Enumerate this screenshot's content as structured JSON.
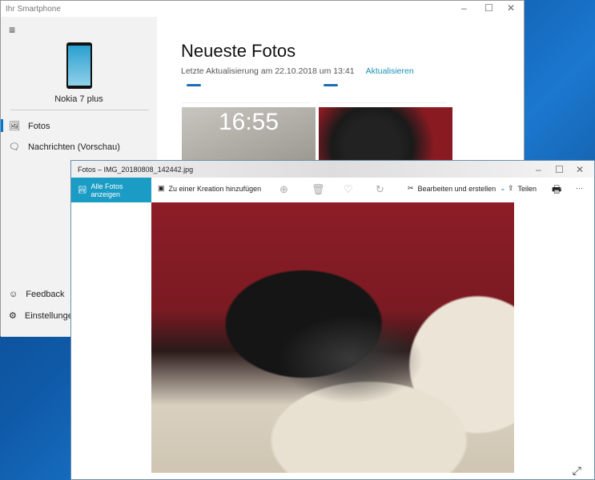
{
  "phone_app": {
    "title": "Ihr Smartphone",
    "device": "Nokia 7 plus",
    "nav": [
      "Fotos",
      "Nachrichten (Vorschau)"
    ],
    "bottom_nav": [
      "Feedback",
      "Einstellungen"
    ],
    "heading": "Neueste Fotos",
    "last_update": "Letzte Aktualisierung am 22.10.2018 um 13:41",
    "refresh": "Aktualisieren",
    "thumb_time": "16:55"
  },
  "photos_app": {
    "title": "Fotos – IMG_20180808_142442.jpg",
    "all_photos": "Alle Fotos anzeigen",
    "add_creation": "Zu einer Kreation hinzufügen",
    "edit": "Bearbeiten und erstellen",
    "share": "Teilen"
  }
}
